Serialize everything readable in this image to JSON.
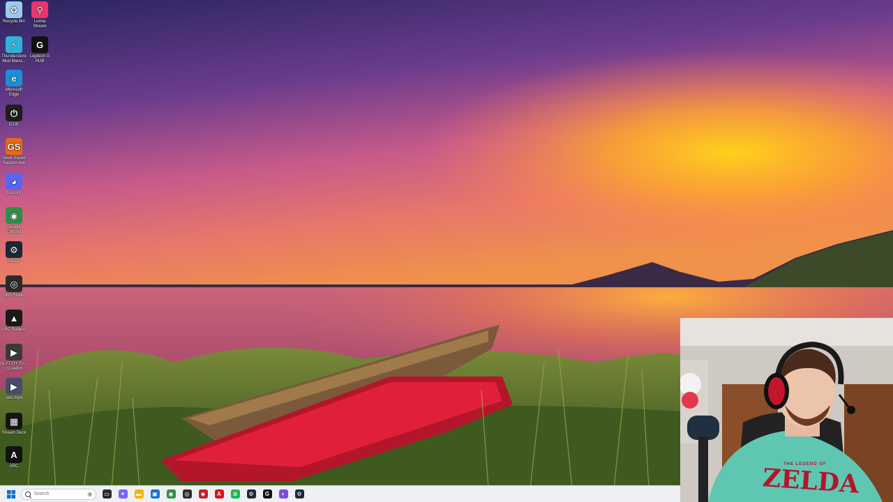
{
  "desktop": {
    "icons": [
      {
        "label": "Recycle Bin",
        "icon": "recycle-bin-icon",
        "color": "#9cc9ef",
        "glyph": "♻"
      },
      {
        "label": "Lumia\nStream",
        "icon": "lumia-stream-icon",
        "color": "#e8356b",
        "glyph": "⚲"
      },
      {
        "label": "Thunderstore\nMod Mana...",
        "icon": "thunderstore-icon",
        "color": "#2fb1d8",
        "glyph": "⚡"
      },
      {
        "label": "Logitech G\nHUB",
        "icon": "logitech-g-hub-icon",
        "color": "#111111",
        "glyph": "G"
      },
      {
        "label": "Microsoft\nEdge",
        "icon": "microsoft-edge-icon",
        "color": "#1b8fd6",
        "glyph": "e"
      },
      {
        "label": "iCUE",
        "icon": "icue-icon",
        "color": "#1e1e1e",
        "glyph": "⏻"
      },
      {
        "label": "Geek Squad\nSupport.exe",
        "icon": "geek-squad-icon",
        "color": "#e86a12",
        "glyph": "GS"
      },
      {
        "label": "Discord",
        "icon": "discord-icon",
        "color": "#5865f2",
        "glyph": "◕"
      },
      {
        "label": "Google\nChrome",
        "icon": "google-chrome-icon",
        "color": "#2f8f46",
        "glyph": "◉"
      },
      {
        "label": "Steam",
        "icon": "steam-icon",
        "color": "#1b2838",
        "glyph": "⚙"
      },
      {
        "label": "OBS Studio",
        "icon": "obs-studio-icon",
        "color": "#2b2b2b",
        "glyph": "◎"
      },
      {
        "label": "ARC Raiders",
        "icon": "arc-raiders-icon",
        "color": "#1a1a1a",
        "glyph": "▲"
      },
      {
        "label": "GLYTCH_En...\n(1).webm",
        "icon": "webm-file-icon",
        "color": "#3a3a3a",
        "glyph": "▶"
      },
      {
        "label": "tatic.mp4",
        "icon": "mp4-file-icon",
        "color": "#4a4a6a",
        "glyph": "▶"
      },
      {
        "label": "Stream Deck",
        "icon": "stream-deck-icon",
        "color": "#151515",
        "glyph": "▦"
      },
      {
        "label": "ARC",
        "icon": "arc-icon",
        "color": "#111111",
        "glyph": "A"
      }
    ]
  },
  "taskbar": {
    "search_placeholder": "Search",
    "apps": [
      {
        "name": "task-view-icon",
        "color": "#2a2a2a",
        "glyph": "▭"
      },
      {
        "name": "copilot-icon",
        "color": "#7b61ff",
        "glyph": "✦"
      },
      {
        "name": "file-explorer-icon",
        "color": "#f2b600",
        "glyph": "▬"
      },
      {
        "name": "microsoft-store-icon",
        "color": "#1b6fd1",
        "glyph": "▣"
      },
      {
        "name": "google-chrome-icon",
        "color": "#2f8f46",
        "glyph": "◉"
      },
      {
        "name": "obs-studio-icon",
        "color": "#2b2b2b",
        "glyph": "◎"
      },
      {
        "name": "app-red-icon",
        "color": "#c4202b",
        "glyph": "◆"
      },
      {
        "name": "adobe-icon",
        "color": "#d4141a",
        "glyph": "A"
      },
      {
        "name": "spotify-icon",
        "color": "#1db954",
        "glyph": "≋"
      },
      {
        "name": "steam-icon",
        "color": "#1b2838",
        "glyph": "⚙"
      },
      {
        "name": "logitech-g-hub-icon",
        "color": "#111111",
        "glyph": "G"
      },
      {
        "name": "lumia-stream-icon",
        "color": "#7a4dd8",
        "glyph": "◐"
      },
      {
        "name": "steam-icon",
        "color": "#1b2838",
        "glyph": "⚙"
      }
    ]
  },
  "webcam": {
    "shirt_text": "ZELDA",
    "shirt_subtext": "THE LEGEND OF"
  }
}
